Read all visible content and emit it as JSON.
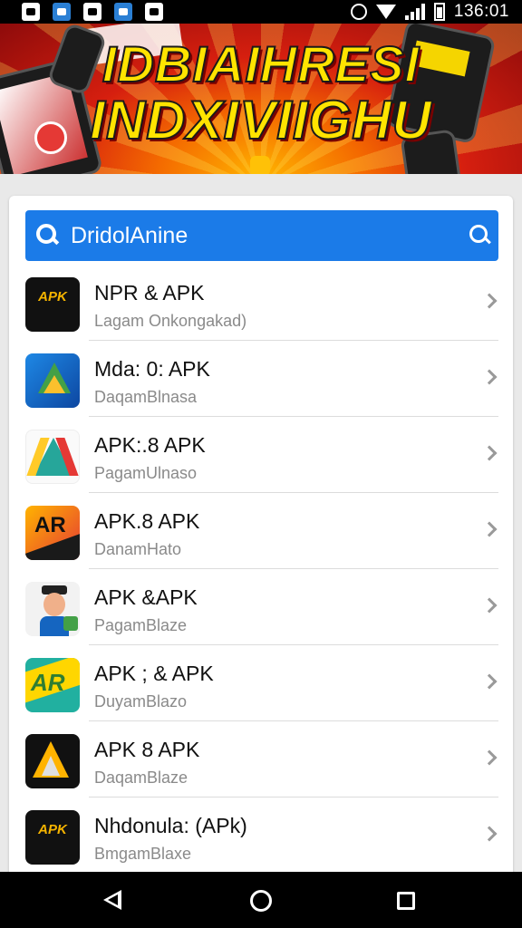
{
  "status_bar": {
    "time": "136:01",
    "left_icons": [
      "notification-square-icon",
      "a-app-icon",
      "notification-camera-icon",
      "notification-blue-icon",
      "notification-gift-icon"
    ],
    "right_icons": [
      "alarm-icon",
      "wifi-icon",
      "signal-icon",
      "battery-icon"
    ]
  },
  "banner": {
    "line1": "IDBIAIHRESI",
    "line2": "INDXIVIIGHU"
  },
  "search": {
    "text": "DridolAnine",
    "icon": "search-icon",
    "button_icon": "search-icon"
  },
  "apps": [
    {
      "title": "NPR & APK",
      "subtitle": "Lagam Onkongakad)",
      "icon": "red-black-logo-icon"
    },
    {
      "title": "Mda: 0: APK",
      "subtitle": "DaqamBlnasa",
      "icon": "blue-play-triangle-icon"
    },
    {
      "title": "APK:.8 APK",
      "subtitle": "PagamUlnaso",
      "icon": "white-triangle-logo-icon"
    },
    {
      "title": "APK.8 APK",
      "subtitle": "DanamHato",
      "icon": "orange-black-logo-icon"
    },
    {
      "title": "APK &APK",
      "subtitle": "PagamBlaze",
      "icon": "person-avatar-icon"
    },
    {
      "title": "APK ; & APK",
      "subtitle": "DuyamBlazo",
      "icon": "yellow-green-logo-icon"
    },
    {
      "title": "APK 8 APK",
      "subtitle": "DaqamBlaze",
      "icon": "black-triangle-logo-icon"
    },
    {
      "title": "Nhdonula: (APk)",
      "subtitle": "BmgamBlaxe",
      "icon": "red-black-logo-icon"
    }
  ],
  "nav_bar": {
    "icons": [
      "back-icon",
      "home-icon",
      "recent-apps-icon"
    ]
  },
  "colors": {
    "search_bar": "#1b7be8",
    "banner_red": "#d61f0f",
    "banner_yellow": "#ffe400"
  }
}
